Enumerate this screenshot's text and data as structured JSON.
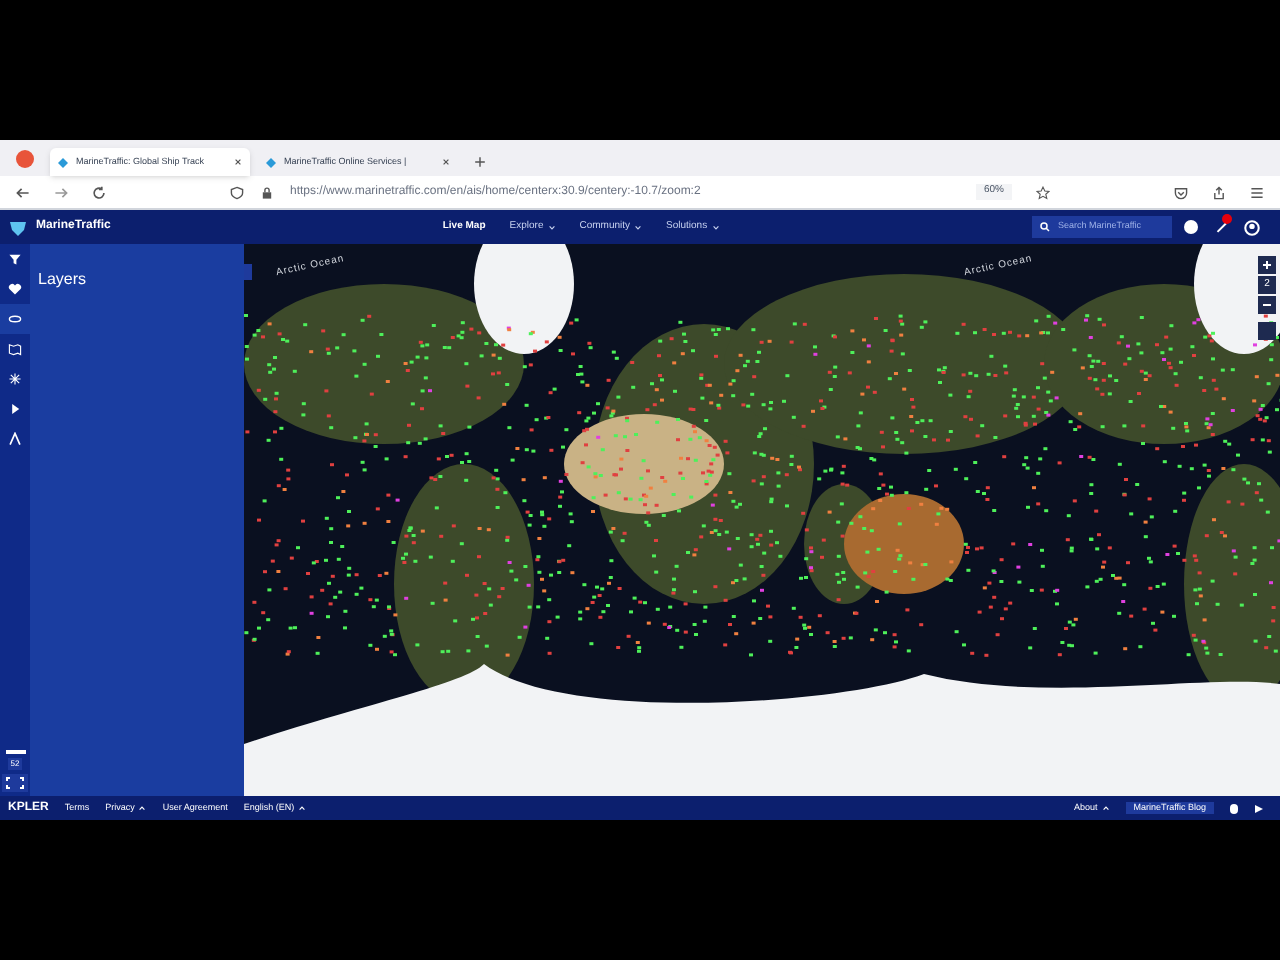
{
  "browser": {
    "tabs": [
      {
        "title": "MarineTraffic: Global Ship Track",
        "selected": true
      },
      {
        "title": "MarineTraffic Online Services |",
        "selected": false
      }
    ],
    "url": "https://www.marinetraffic.com/en/ais/home/centerx:30.9/centery:-10.7/zoom:2",
    "zoom": "60%"
  },
  "header": {
    "brand": "MarineTraffic",
    "nav": [
      {
        "label": "Live Map",
        "dropdown": false
      },
      {
        "label": "Explore",
        "dropdown": true
      },
      {
        "label": "Community",
        "dropdown": true
      },
      {
        "label": "Solutions",
        "dropdown": true
      }
    ],
    "search": {
      "placeholder": "Search MarineTraffic"
    }
  },
  "rail": [
    {
      "kind": "filter",
      "selected": false
    },
    {
      "kind": "heart",
      "selected": false
    },
    {
      "kind": "layers",
      "selected": true
    },
    {
      "kind": "map",
      "selected": false
    },
    {
      "kind": "weather",
      "selected": false
    },
    {
      "kind": "play",
      "selected": false
    },
    {
      "kind": "measure",
      "selected": false
    }
  ],
  "rail_bottom": {
    "count": "52"
  },
  "panel": {
    "title": "Layers"
  },
  "map": {
    "labels": [
      "Arctic Ocean",
      "Arctic Ocean"
    ],
    "zoom_level": "2"
  },
  "footer": {
    "brand": "KPLER",
    "links": [
      {
        "label": "Terms",
        "dropdown": false
      },
      {
        "label": "Privacy",
        "dropdown": true
      },
      {
        "label": "User Agreement",
        "dropdown": false
      },
      {
        "label": "English (EN)",
        "dropdown": true
      }
    ],
    "about": "About",
    "blog": "MarineTraffic Blog"
  }
}
